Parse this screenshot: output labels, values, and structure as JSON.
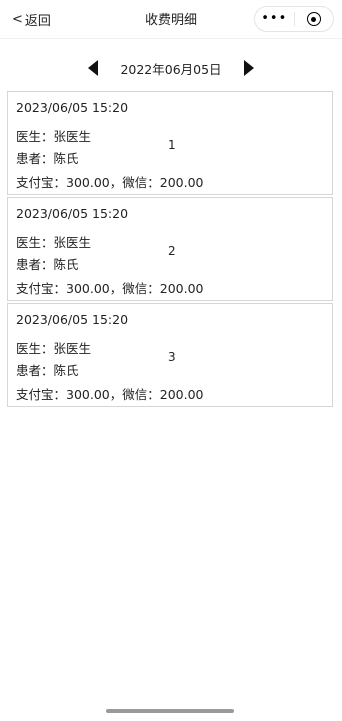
{
  "navbar": {
    "back_label": "返回",
    "back_chevron": "<",
    "title": "收费明细",
    "more_icon": "•••"
  },
  "date_bar": {
    "date": "2022年06月05日"
  },
  "records": [
    {
      "datetime": "2023/06/05  15:20",
      "doctor": "医生：张医生",
      "patient": "患者：陈氏",
      "payment": "支付宝：300.00，微信：200.00",
      "index": "1"
    },
    {
      "datetime": "2023/06/05  15:20",
      "doctor": "医生：张医生",
      "patient": "患者：陈氏",
      "payment": "支付宝：300.00，微信：200.00",
      "index": "2"
    },
    {
      "datetime": "2023/06/05  15:20",
      "doctor": "医生：张医生",
      "patient": "患者：陈氏",
      "payment": "支付宝：300.00，微信：200.00",
      "index": "3"
    }
  ]
}
